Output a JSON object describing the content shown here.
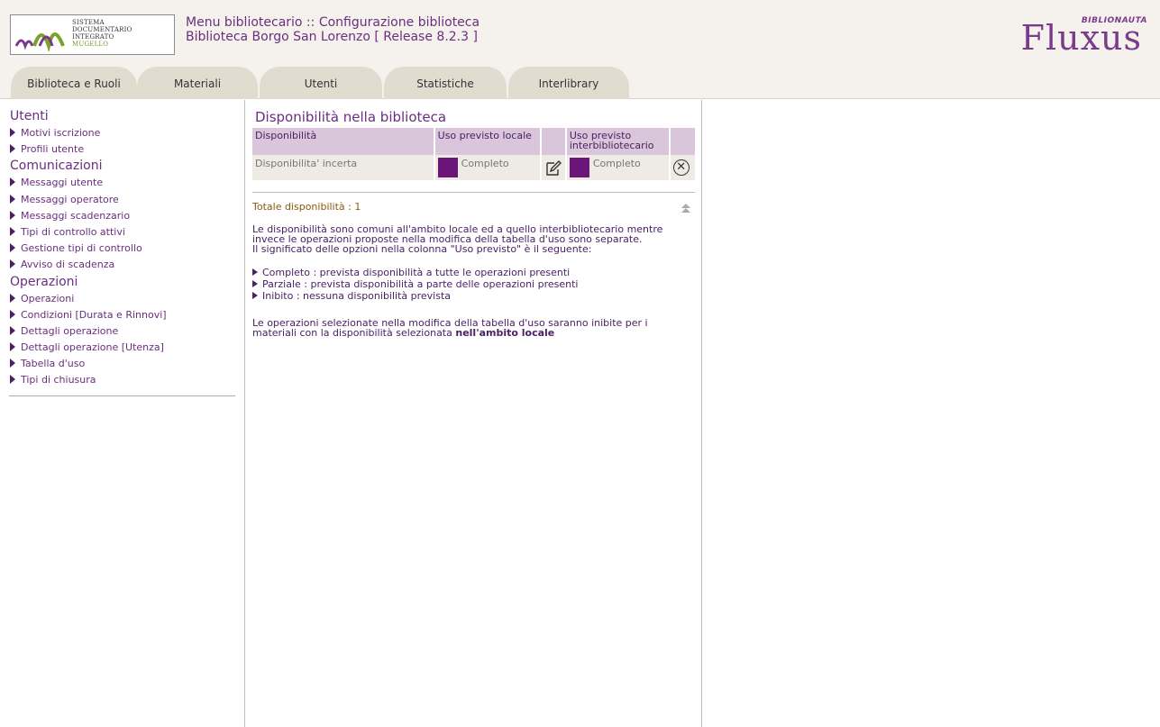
{
  "logo": {
    "lines": [
      "SISTEMA",
      "DOCUMENTARIO",
      "INTEGRATO",
      "MUGELLO"
    ]
  },
  "header": {
    "line1": "Menu bibliotecario :: Configurazione biblioteca",
    "line2": "Biblioteca Borgo San Lorenzo [ Release 8.2.3 ]",
    "brand_small": "BIBLIONAUTA",
    "brand_big": "Fluxus"
  },
  "tabs": [
    "Biblioteca e Ruoli",
    "Materiali",
    "Utenti",
    "Statistiche",
    "Interlibrary"
  ],
  "sidebar": {
    "sec1": "Utenti",
    "sec1_items": [
      "Motivi iscrizione",
      "Profili utente"
    ],
    "sec2": "Comunicazioni",
    "sec2_items": [
      "Messaggi utente",
      "Messaggi operatore",
      "Messaggi scadenzario",
      "Tipi di controllo attivi",
      "Gestione tipi di controllo",
      "Avviso di scadenza"
    ],
    "sec3": "Operazioni",
    "sec3_items": [
      "Operazioni",
      "Condizioni [Durata e Rinnovi]",
      "Dettagli operazione",
      "Dettagli operazione [Utenza]",
      "Tabella d'uso",
      "Tipi di chiusura"
    ]
  },
  "main": {
    "title": "Disponibilità nella biblioteca",
    "table": {
      "col1": "Disponibilità",
      "col2": "Uso previsto locale",
      "col3": "Uso previsto interbibliotecario",
      "row": {
        "name": "Disponibilita' incerta",
        "local": "Completo",
        "inter": "Completo"
      }
    },
    "total": "Totale disponibilità : 1",
    "para1": "Le disponibilità sono comuni all'ambito locale ed a quello interbibliotecario mentre invece le operazioni proposte nella modifica della tabella d'uso sono separate.",
    "para1b": "Il significato delle opzioni nella colonna \"Uso previsto\" è il seguente:",
    "options": [
      "Completo : prevista disponibilità a tutte le operazioni presenti",
      "Parziale : prevista disponibilità a parte delle operazioni presenti",
      "Inibito : nessuna disponibilità prevista"
    ],
    "para2": "Le operazioni selezionate nella modifica della tabella d'uso saranno inibite per i materiali con la disponibilità selezionata",
    "para2_bold": "nell'ambito locale"
  },
  "colors": {
    "accent": "#6a2e7f",
    "swatch": "#6b1579",
    "table_header": "#d9c6da",
    "tab_bg": "#e2dcd0"
  }
}
